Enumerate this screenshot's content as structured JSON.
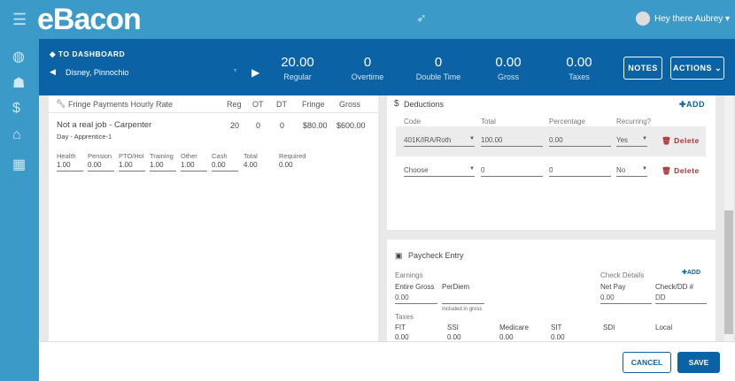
{
  "app": {
    "logo": "eBacon",
    "user": "Hey there Aubrey ▾"
  },
  "header": {
    "back": "◆ TO DASHBOARD",
    "employee": "Disney, Pinnochio",
    "stats": [
      {
        "value": "20.00",
        "label": "Regular"
      },
      {
        "value": "0",
        "label": "Overtime"
      },
      {
        "value": "0",
        "label": "Double Time"
      },
      {
        "value": "0.00",
        "label": "Gross"
      },
      {
        "value": "0.00",
        "label": "Taxes"
      }
    ],
    "notes": "NOTES",
    "actions": "ACTIONS ⌄"
  },
  "fringe": {
    "title": "Fringe Payments Hourly Rate",
    "cols": [
      "Reg",
      "OT",
      "DT",
      "Fringe",
      "Gross"
    ],
    "job": "Not a real job - Carpenter",
    "sub": "Day - Apprentice-1",
    "vals": [
      "20",
      "0",
      "0",
      "$80.00",
      "$600.00"
    ],
    "fields": [
      {
        "label": "Health",
        "value": "1.00"
      },
      {
        "label": "Pension",
        "value": "0.00"
      },
      {
        "label": "PTO/Hol",
        "value": "1.00"
      },
      {
        "label": "Training",
        "value": "1.00"
      },
      {
        "label": "Other",
        "value": "1.00"
      },
      {
        "label": "Cash",
        "value": "0.00"
      },
      {
        "label": "Total",
        "value": "4.00"
      },
      {
        "label": "Required",
        "value": "0.00"
      }
    ]
  },
  "deductions": {
    "title": "Deductions",
    "add": "ADD",
    "cols": [
      "Code",
      "Total",
      "Percentage",
      "Recurring?"
    ],
    "rows": [
      {
        "code": "401K/IRA/Roth",
        "total": "100.00",
        "pct": "0.00",
        "rec": "Yes",
        "del": "Delete"
      },
      {
        "code": "Choose",
        "total": "0",
        "pct": "0",
        "rec": "No",
        "del": "Delete"
      }
    ]
  },
  "paycheck": {
    "title": "Paycheck Entry",
    "earnings": "Earnings",
    "entire_gross": "Entire Gross",
    "entire_gross_v": "0.00",
    "perdiem": "PerDiem",
    "included": "Included in gross",
    "check_details": "Check Details",
    "add": "ADD",
    "net_pay": "Net Pay",
    "net_pay_v": "0.00",
    "check": "Check/DD #",
    "check_v": "DD",
    "taxes": "Taxes",
    "tax_fields": [
      {
        "label": "FIT",
        "value": "0.00"
      },
      {
        "label": "SSI",
        "value": "0.00"
      },
      {
        "label": "Medicare",
        "value": "0.00"
      },
      {
        "label": "SIT",
        "value": "0.00"
      },
      {
        "label": "SDI",
        "value": ""
      },
      {
        "label": "Local",
        "value": ""
      }
    ]
  },
  "footer": {
    "cancel": "CANCEL",
    "save": "SAVE"
  }
}
